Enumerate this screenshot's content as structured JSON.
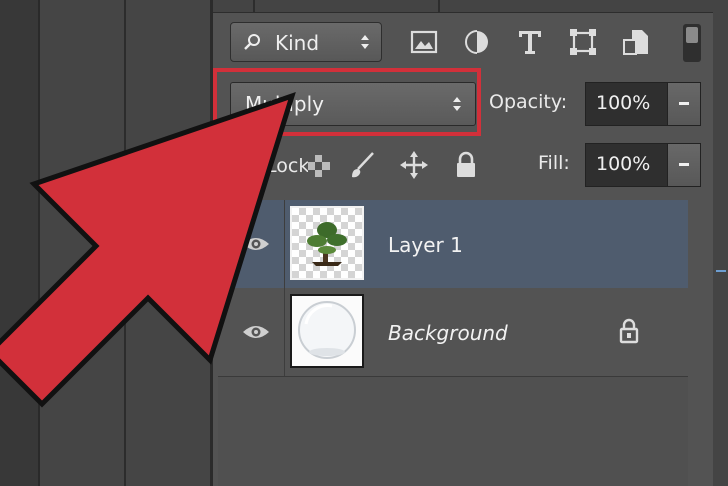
{
  "filter": {
    "kind_label": "Kind",
    "icons": [
      "image-filter-icon",
      "adjustment-filter-icon",
      "type-filter-icon",
      "shape-filter-icon",
      "smart-object-filter-icon"
    ]
  },
  "blend": {
    "mode": "Multiply",
    "opacity_label": "Opacity:",
    "opacity_value": "100%"
  },
  "lock": {
    "label": "Lock:",
    "fill_label": "Fill:",
    "fill_value": "100%"
  },
  "layers": [
    {
      "name": "Layer 1",
      "visible": true,
      "selected": true,
      "locked": false
    },
    {
      "name": "Background",
      "visible": true,
      "selected": false,
      "locked": true
    }
  ],
  "colors": {
    "annotation_red": "#d2303a",
    "selected_row": "#4f5c6e",
    "panel_bg": "#535353"
  }
}
